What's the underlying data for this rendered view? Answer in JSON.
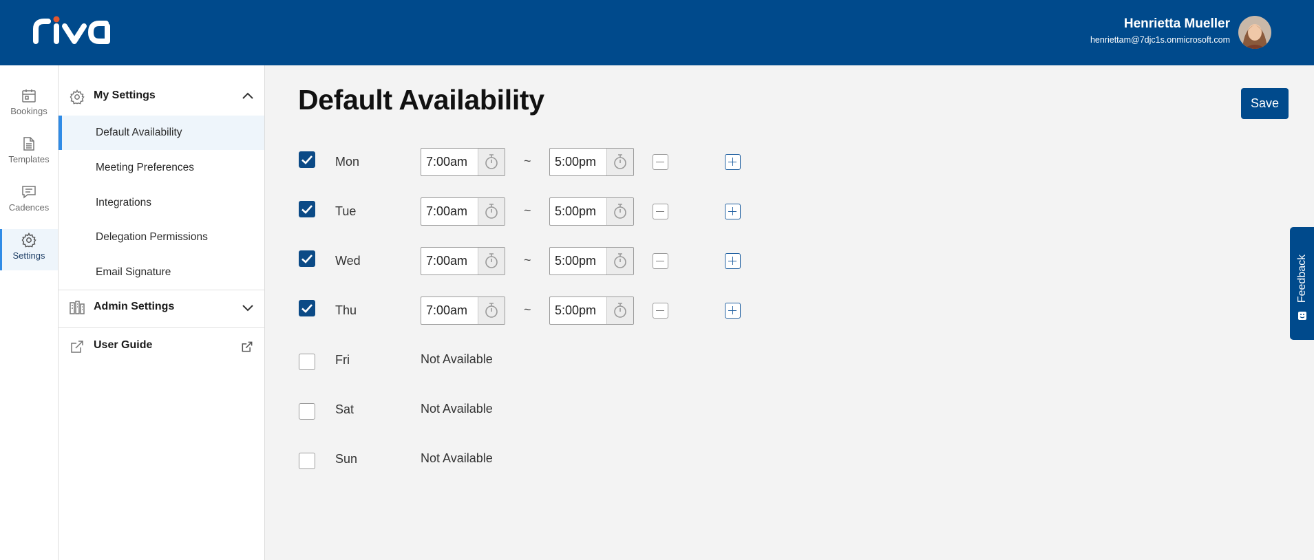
{
  "header": {
    "logo_text": "riva",
    "user_name": "Henrietta Mueller",
    "user_email": "henriettam@7djc1s.onmicrosoft.com"
  },
  "rail": {
    "items": [
      {
        "label": "Bookings",
        "icon": "calendar-icon"
      },
      {
        "label": "Templates",
        "icon": "document-icon"
      },
      {
        "label": "Cadences",
        "icon": "message-icon"
      },
      {
        "label": "Settings",
        "icon": "gear-icon",
        "active": true
      }
    ]
  },
  "subnav": {
    "my_settings": {
      "label": "My Settings",
      "expanded": true,
      "items": [
        {
          "label": "Default Availability",
          "active": true
        },
        {
          "label": "Meeting Preferences"
        },
        {
          "label": "Integrations"
        },
        {
          "label": "Delegation Permissions"
        },
        {
          "label": "Email Signature"
        }
      ]
    },
    "admin_settings": {
      "label": "Admin Settings",
      "expanded": false
    },
    "user_guide": {
      "label": "User Guide"
    }
  },
  "main": {
    "title": "Default Availability",
    "save_label": "Save",
    "separator": "~",
    "not_available_text": "Not Available",
    "days": [
      {
        "day": "Mon",
        "enabled": true,
        "start": "7:00am",
        "end": "5:00pm"
      },
      {
        "day": "Tue",
        "enabled": true,
        "start": "7:00am",
        "end": "5:00pm"
      },
      {
        "day": "Wed",
        "enabled": true,
        "start": "7:00am",
        "end": "5:00pm"
      },
      {
        "day": "Thu",
        "enabled": true,
        "start": "7:00am",
        "end": "5:00pm"
      },
      {
        "day": "Fri",
        "enabled": false,
        "status": "Not Available"
      },
      {
        "day": "Sat",
        "enabled": false,
        "status": "Not Available"
      },
      {
        "day": "Sun",
        "enabled": false,
        "status": "Not Available"
      }
    ]
  },
  "feedback": {
    "label": "Feedback"
  },
  "colors": {
    "brand": "#004a8c",
    "accent": "#2f8be6",
    "checkbox": "#0b4a86"
  }
}
